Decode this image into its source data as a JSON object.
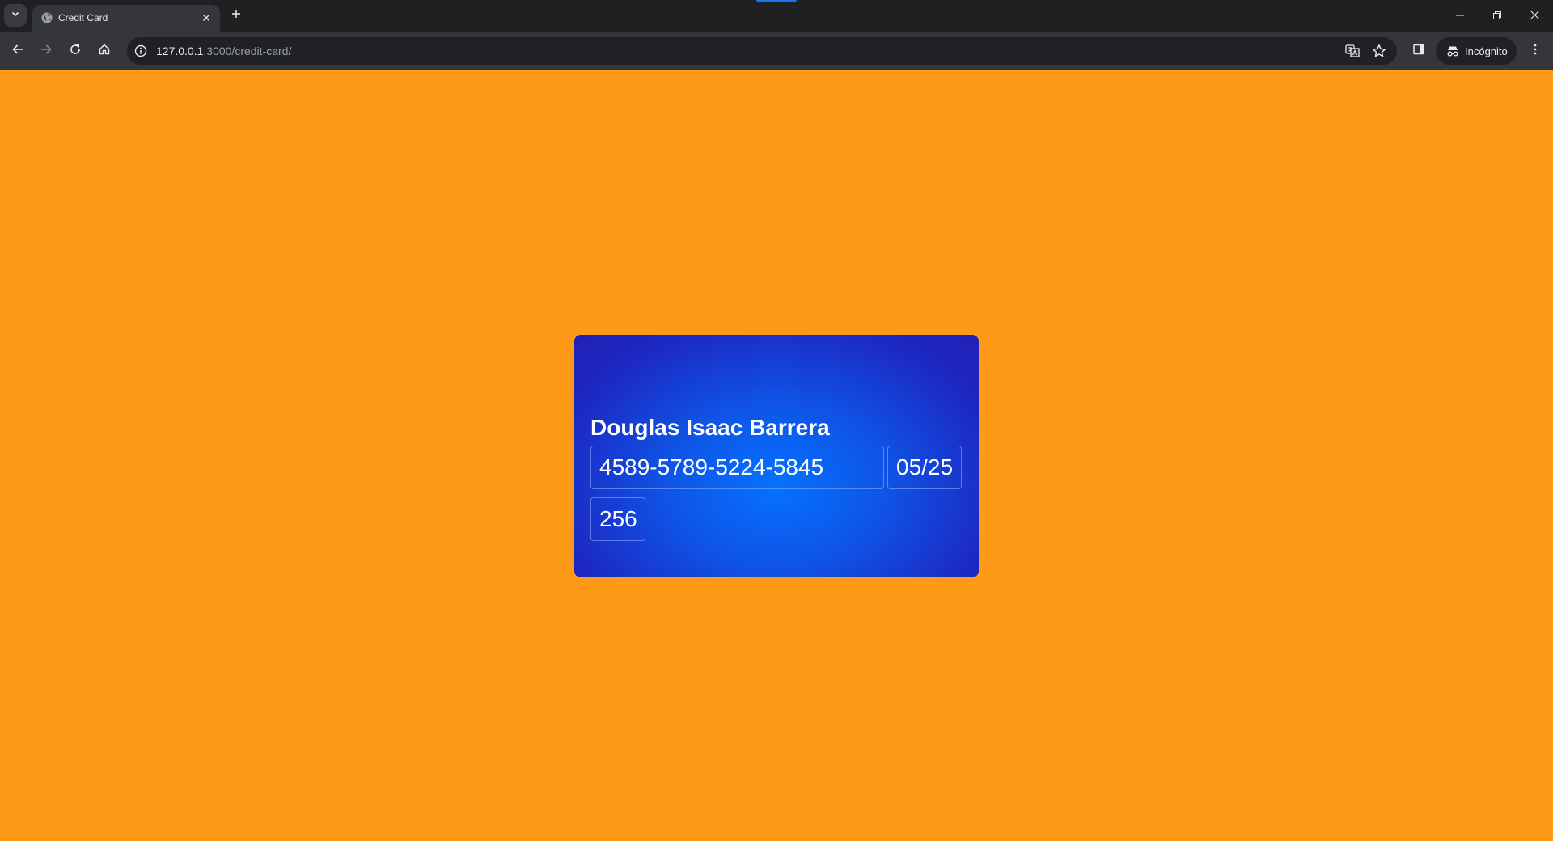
{
  "browser": {
    "tab": {
      "title": "Credit Card"
    },
    "omnibox": {
      "url_host": "127.0.0.1",
      "url_rest": ":3000/credit-card/"
    },
    "profile": {
      "label": "Incógnito"
    }
  },
  "card": {
    "holder_name": "Douglas Isaac Barrera",
    "number": "4589-5789-5224-5845",
    "expiry": "05/25",
    "cvv": "256"
  },
  "colors": {
    "page_background": "#ff9a18",
    "card_center": "#0572ff",
    "card_edge": "#2120b5",
    "chrome_dark": "#1f2022",
    "chrome_toolbar": "#35363a"
  },
  "icons": {
    "tab_search": "chevron-down-icon",
    "favicon": "globe-icon",
    "tab_close": "close-icon",
    "new_tab": "plus-icon",
    "back": "arrow-left-icon",
    "forward": "arrow-right-icon",
    "reload": "reload-icon",
    "home": "home-icon",
    "site_info": "info-icon",
    "translate": "translate-icon",
    "bookmark": "star-icon",
    "side_panel": "side-panel-icon",
    "incognito": "incognito-icon",
    "menu": "kebab-menu-icon",
    "minimize": "minimize-icon",
    "restore": "restore-icon",
    "close_window": "close-icon"
  }
}
